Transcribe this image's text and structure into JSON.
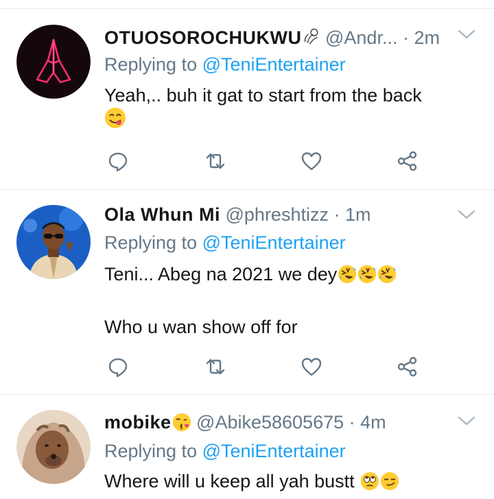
{
  "colors": {
    "text": "#14171a",
    "secondary": "#657786",
    "link": "#1da1f2",
    "divider": "#e6ecf0"
  },
  "reply_prefix": "Replying to",
  "tweets": [
    {
      "display_name": "OTUOSOROCHUKWU",
      "name_emoji": "meteor-emoji",
      "handle": "@Andr...",
      "separator": "·",
      "time": "2m",
      "reply_to": "@TeniEntertainer",
      "text_line1": "Yeah,.. buh it gat to start from the back",
      "text_emojis": [
        "yum-face-emoji"
      ],
      "avatar": "praying-hands-neon-avatar"
    },
    {
      "display_name": "Ola Whun Mi",
      "handle": "@phreshtizz",
      "separator": "·",
      "time": "1m",
      "reply_to": "@TeniEntertainer",
      "text_line1": "Teni... Abeg na 2021 we dey",
      "text_emojis": [
        "rofl-emoji",
        "rofl-emoji",
        "rofl-emoji"
      ],
      "text_line2": "Who u wan show off for",
      "avatar": "man-with-sunglasses-avatar"
    },
    {
      "display_name": "mobike",
      "name_emoji": "kissing-face-emoji",
      "handle": "@Abike58605675",
      "separator": "·",
      "time": "4m",
      "reply_to": "@TeniEntertainer",
      "text_line1": "Where will u keep all yah bustt",
      "text_emojis": [
        "eye-roll-emoji",
        "smirk-emoji"
      ],
      "avatar": "woman-with-hijab-avatar"
    }
  ]
}
